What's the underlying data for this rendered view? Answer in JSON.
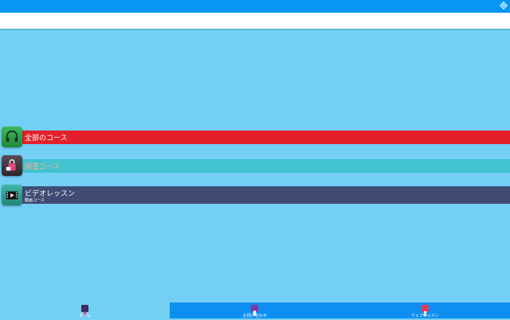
{
  "header": {
    "settings_icon": "gear-icon"
  },
  "list": [
    {
      "label": "全部のコース",
      "icon": "headphones-icon",
      "bar_color": "#e51f2a"
    },
    {
      "label": "調査コース",
      "icon": "shopping-bag-icon",
      "bar_color": "#43c2cf"
    },
    {
      "label": "ビデオレッスン",
      "sublabel": "動画コース",
      "icon": "video-icon",
      "bar_color": "#404c74"
    }
  ],
  "bottom_nav": [
    {
      "label": "ホーム",
      "icon": "home-icon",
      "active": true
    },
    {
      "label": "お問い合わせ",
      "icon": "phone-icon",
      "active": false
    },
    {
      "label": "ウェブレッスン",
      "icon": "web-lesson-icon",
      "active": false
    }
  ]
}
